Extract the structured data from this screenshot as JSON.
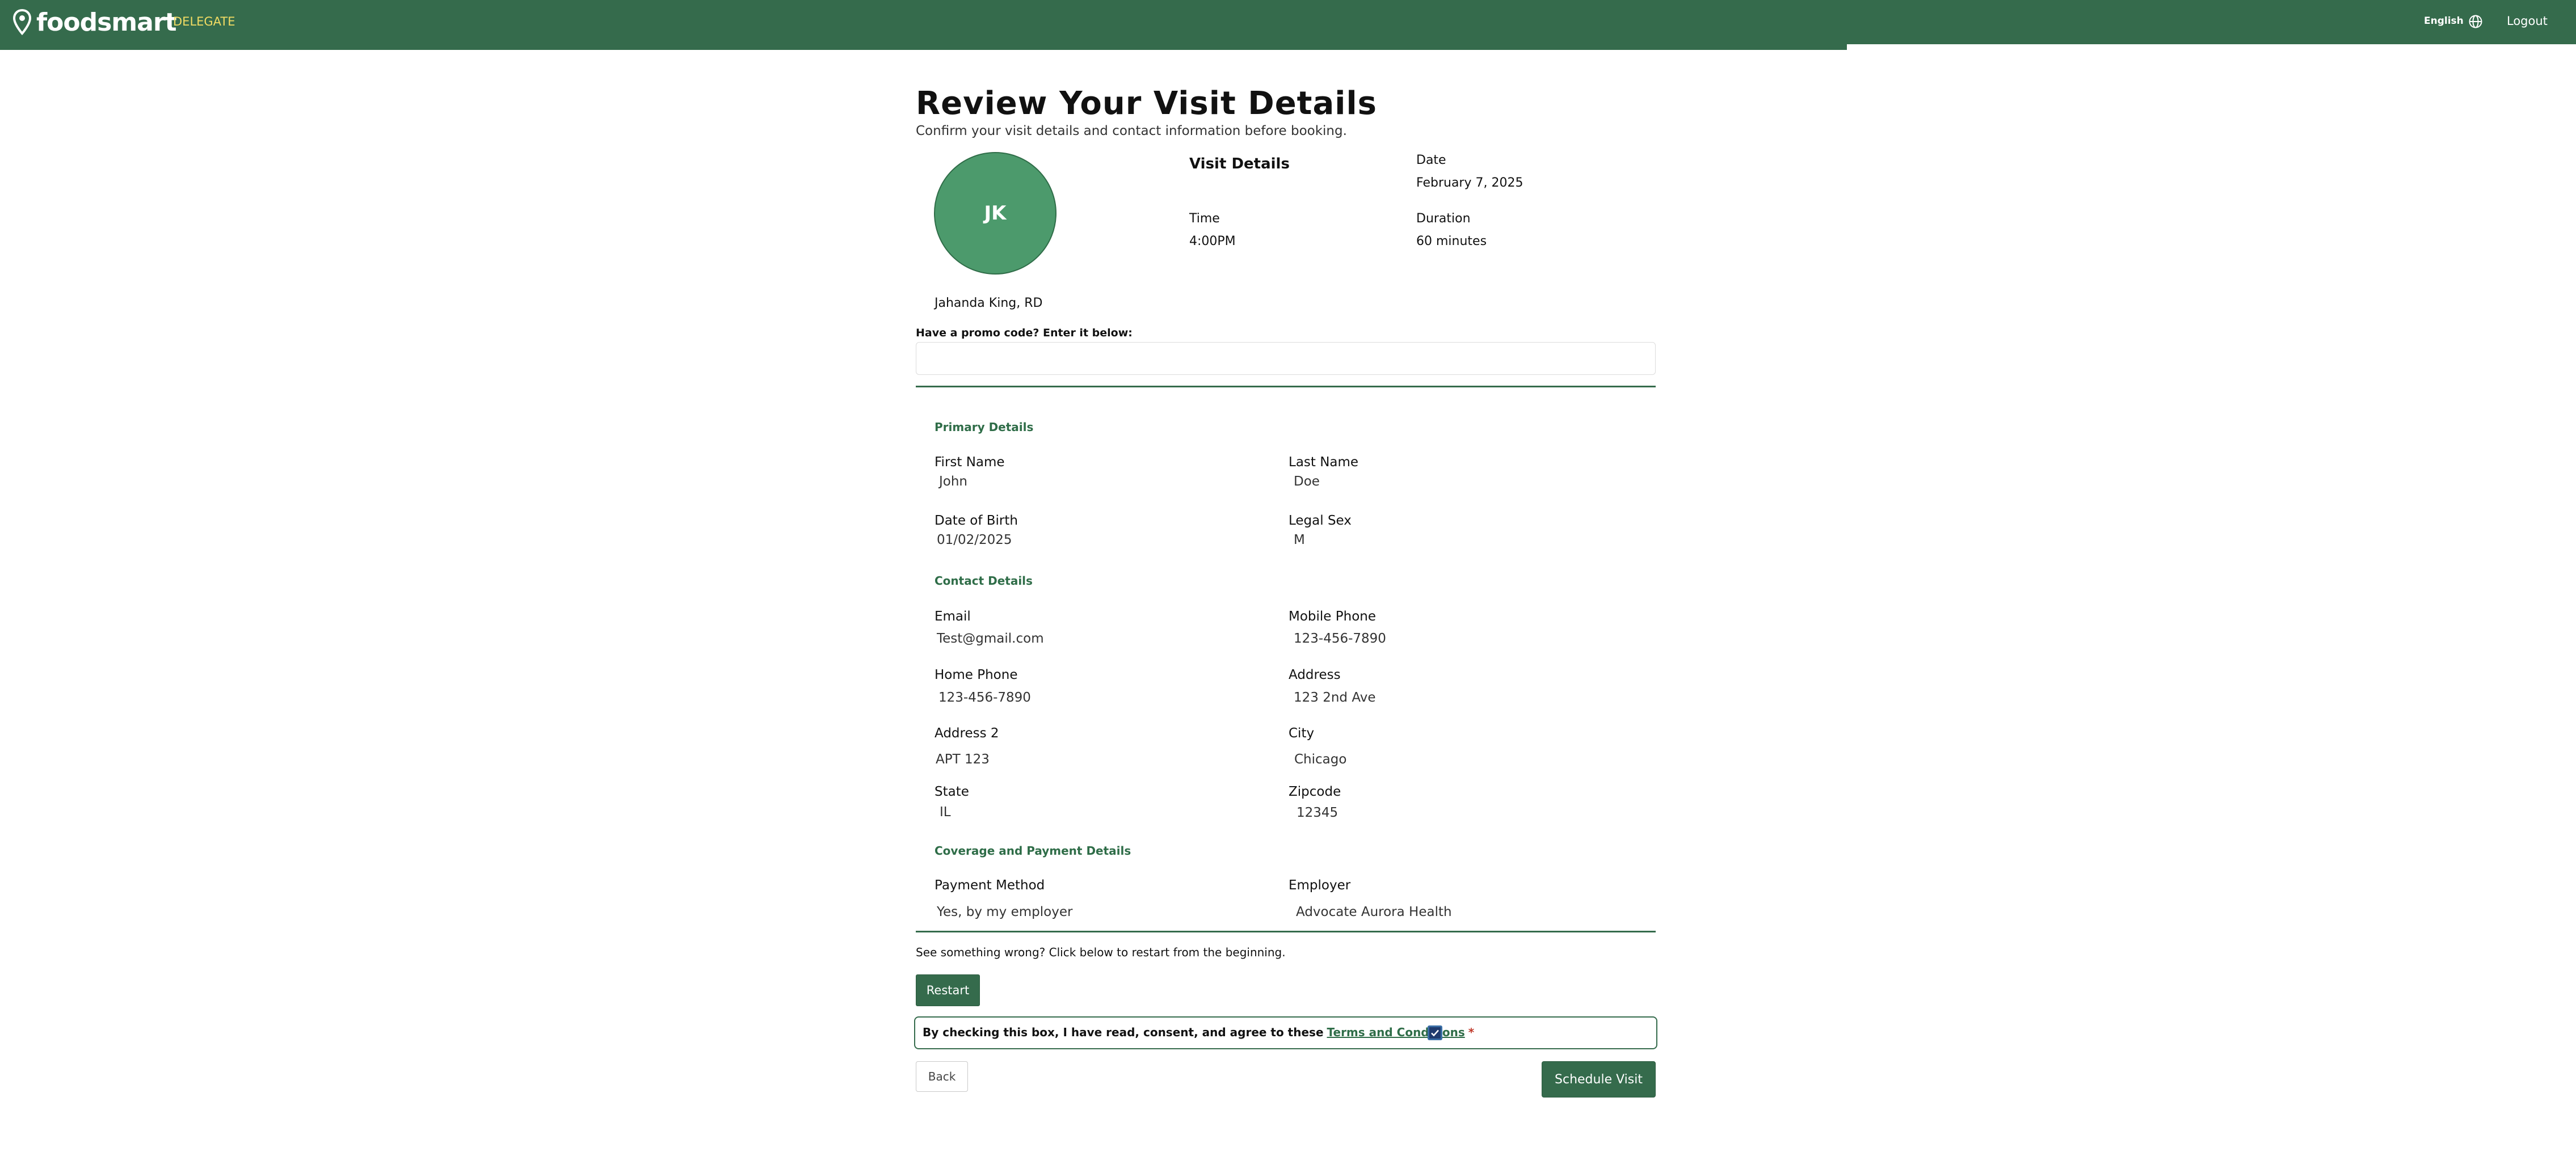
{
  "header": {
    "brand": "foodsmart",
    "delegate_label": "DELEGATE",
    "language_label": "English",
    "logout_label": "Logout",
    "progress_fraction": 0.717,
    "brand_color": "#356b4c"
  },
  "page": {
    "title": "Review Your Visit Details",
    "subtitle": "Confirm your visit details and contact information before booking."
  },
  "provider": {
    "initials": "JK",
    "name": "Jahanda King, RD"
  },
  "visit_details": {
    "heading": "Visit Details",
    "date_label": "Date",
    "date_value": "February 7, 2025",
    "time_label": "Time",
    "time_value": "4:00PM",
    "duration_label": "Duration",
    "duration_value": "60 minutes"
  },
  "promo": {
    "label": "Have a promo code? Enter it below:",
    "value": "",
    "placeholder": ""
  },
  "primary_details": {
    "title": "Primary Details",
    "first_name_label": "First Name",
    "first_name_value": "John",
    "last_name_label": "Last Name",
    "last_name_value": "Doe",
    "dob_label": "Date of Birth",
    "dob_value": "01/02/2025",
    "sex_label": "Legal Sex",
    "sex_value": "M"
  },
  "contact_details": {
    "title": "Contact Details",
    "email_label": "Email",
    "email_value": "Test@gmail.com",
    "mobile_label": "Mobile Phone",
    "mobile_value": "123-456-7890",
    "home_label": "Home Phone",
    "home_value": "123-456-7890",
    "address_label": "Address",
    "address_value": "123 2nd Ave",
    "address2_label": "Address 2",
    "address2_value": "APT 123",
    "city_label": "City",
    "city_value": "Chicago",
    "state_label": "State",
    "state_value": "IL",
    "zip_label": "Zipcode",
    "zip_value": "12345"
  },
  "coverage": {
    "title": "Coverage and Payment Details",
    "payment_label": "Payment Method",
    "payment_value": "Yes, by my employer",
    "employer_label": "Employer",
    "employer_value": "Advocate Aurora Health"
  },
  "footer": {
    "wrong_text": "See something wrong? Click below to restart from the beginning.",
    "restart_label": "Restart",
    "consent_text": "By checking this box, I have read, consent, and agree to these",
    "terms_label": "Terms and Conditions",
    "required_mark": "*",
    "consent_checked": true,
    "back_label": "Back",
    "schedule_label": "Schedule Visit"
  }
}
